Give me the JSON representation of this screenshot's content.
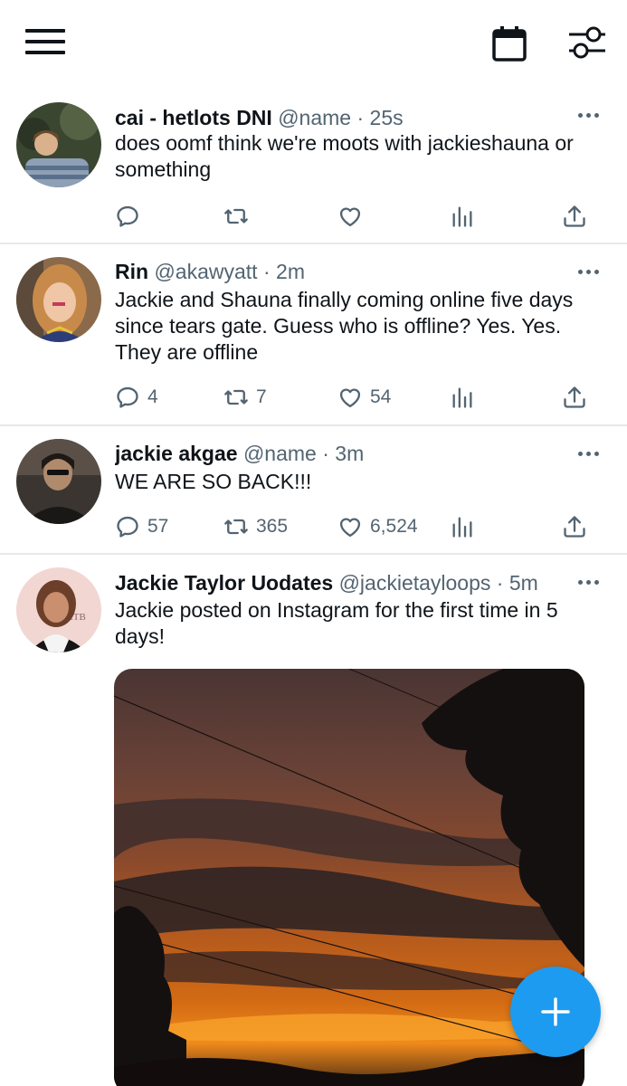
{
  "topbar": {
    "menu_icon": "hamburger-menu-icon",
    "calendar_icon": "calendar-icon",
    "filter_icon": "sliders-filter-icon"
  },
  "tweets": [
    {
      "name": "cai - hetlots DNI",
      "handle": "@name",
      "time": "25s",
      "text": "does oomf think we're moots with jackieshauna or something",
      "replies": "",
      "retweets": "",
      "likes": ""
    },
    {
      "name": "Rin",
      "handle": "@akawyatt",
      "time": "2m",
      "text": "Jackie and Shauna finally coming online five days since tears gate. Guess who is offline? Yes. Yes. They are offline",
      "replies": "4",
      "retweets": "7",
      "likes": "54"
    },
    {
      "name": "jackie akgae",
      "handle": "@name",
      "time": "3m",
      "text": "WE ARE SO BACK!!!",
      "replies": "57",
      "retweets": "365",
      "likes": "6,524"
    },
    {
      "name": "Jackie Taylor Uodates",
      "handle": "@jackietayloops",
      "time": "5m",
      "text": "Jackie posted on Instagram for the first time in 5 days!",
      "media": "sunset-photo"
    }
  ],
  "separator": " · ",
  "fab": {
    "icon": "plus-icon",
    "color": "#1d9bf0"
  }
}
